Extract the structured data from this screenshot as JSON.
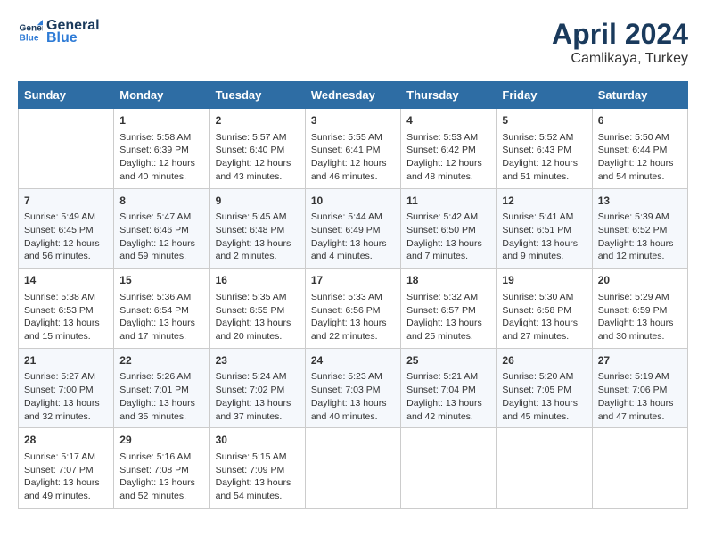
{
  "header": {
    "logo_line1": "General",
    "logo_line2": "Blue",
    "title": "April 2024",
    "subtitle": "Camlikaya, Turkey"
  },
  "columns": [
    "Sunday",
    "Monday",
    "Tuesday",
    "Wednesday",
    "Thursday",
    "Friday",
    "Saturday"
  ],
  "weeks": [
    [
      {
        "day": "",
        "info": ""
      },
      {
        "day": "1",
        "info": "Sunrise: 5:58 AM\nSunset: 6:39 PM\nDaylight: 12 hours\nand 40 minutes."
      },
      {
        "day": "2",
        "info": "Sunrise: 5:57 AM\nSunset: 6:40 PM\nDaylight: 12 hours\nand 43 minutes."
      },
      {
        "day": "3",
        "info": "Sunrise: 5:55 AM\nSunset: 6:41 PM\nDaylight: 12 hours\nand 46 minutes."
      },
      {
        "day": "4",
        "info": "Sunrise: 5:53 AM\nSunset: 6:42 PM\nDaylight: 12 hours\nand 48 minutes."
      },
      {
        "day": "5",
        "info": "Sunrise: 5:52 AM\nSunset: 6:43 PM\nDaylight: 12 hours\nand 51 minutes."
      },
      {
        "day": "6",
        "info": "Sunrise: 5:50 AM\nSunset: 6:44 PM\nDaylight: 12 hours\nand 54 minutes."
      }
    ],
    [
      {
        "day": "7",
        "info": "Sunrise: 5:49 AM\nSunset: 6:45 PM\nDaylight: 12 hours\nand 56 minutes."
      },
      {
        "day": "8",
        "info": "Sunrise: 5:47 AM\nSunset: 6:46 PM\nDaylight: 12 hours\nand 59 minutes."
      },
      {
        "day": "9",
        "info": "Sunrise: 5:45 AM\nSunset: 6:48 PM\nDaylight: 13 hours\nand 2 minutes."
      },
      {
        "day": "10",
        "info": "Sunrise: 5:44 AM\nSunset: 6:49 PM\nDaylight: 13 hours\nand 4 minutes."
      },
      {
        "day": "11",
        "info": "Sunrise: 5:42 AM\nSunset: 6:50 PM\nDaylight: 13 hours\nand 7 minutes."
      },
      {
        "day": "12",
        "info": "Sunrise: 5:41 AM\nSunset: 6:51 PM\nDaylight: 13 hours\nand 9 minutes."
      },
      {
        "day": "13",
        "info": "Sunrise: 5:39 AM\nSunset: 6:52 PM\nDaylight: 13 hours\nand 12 minutes."
      }
    ],
    [
      {
        "day": "14",
        "info": "Sunrise: 5:38 AM\nSunset: 6:53 PM\nDaylight: 13 hours\nand 15 minutes."
      },
      {
        "day": "15",
        "info": "Sunrise: 5:36 AM\nSunset: 6:54 PM\nDaylight: 13 hours\nand 17 minutes."
      },
      {
        "day": "16",
        "info": "Sunrise: 5:35 AM\nSunset: 6:55 PM\nDaylight: 13 hours\nand 20 minutes."
      },
      {
        "day": "17",
        "info": "Sunrise: 5:33 AM\nSunset: 6:56 PM\nDaylight: 13 hours\nand 22 minutes."
      },
      {
        "day": "18",
        "info": "Sunrise: 5:32 AM\nSunset: 6:57 PM\nDaylight: 13 hours\nand 25 minutes."
      },
      {
        "day": "19",
        "info": "Sunrise: 5:30 AM\nSunset: 6:58 PM\nDaylight: 13 hours\nand 27 minutes."
      },
      {
        "day": "20",
        "info": "Sunrise: 5:29 AM\nSunset: 6:59 PM\nDaylight: 13 hours\nand 30 minutes."
      }
    ],
    [
      {
        "day": "21",
        "info": "Sunrise: 5:27 AM\nSunset: 7:00 PM\nDaylight: 13 hours\nand 32 minutes."
      },
      {
        "day": "22",
        "info": "Sunrise: 5:26 AM\nSunset: 7:01 PM\nDaylight: 13 hours\nand 35 minutes."
      },
      {
        "day": "23",
        "info": "Sunrise: 5:24 AM\nSunset: 7:02 PM\nDaylight: 13 hours\nand 37 minutes."
      },
      {
        "day": "24",
        "info": "Sunrise: 5:23 AM\nSunset: 7:03 PM\nDaylight: 13 hours\nand 40 minutes."
      },
      {
        "day": "25",
        "info": "Sunrise: 5:21 AM\nSunset: 7:04 PM\nDaylight: 13 hours\nand 42 minutes."
      },
      {
        "day": "26",
        "info": "Sunrise: 5:20 AM\nSunset: 7:05 PM\nDaylight: 13 hours\nand 45 minutes."
      },
      {
        "day": "27",
        "info": "Sunrise: 5:19 AM\nSunset: 7:06 PM\nDaylight: 13 hours\nand 47 minutes."
      }
    ],
    [
      {
        "day": "28",
        "info": "Sunrise: 5:17 AM\nSunset: 7:07 PM\nDaylight: 13 hours\nand 49 minutes."
      },
      {
        "day": "29",
        "info": "Sunrise: 5:16 AM\nSunset: 7:08 PM\nDaylight: 13 hours\nand 52 minutes."
      },
      {
        "day": "30",
        "info": "Sunrise: 5:15 AM\nSunset: 7:09 PM\nDaylight: 13 hours\nand 54 minutes."
      },
      {
        "day": "",
        "info": ""
      },
      {
        "day": "",
        "info": ""
      },
      {
        "day": "",
        "info": ""
      },
      {
        "day": "",
        "info": ""
      }
    ]
  ]
}
